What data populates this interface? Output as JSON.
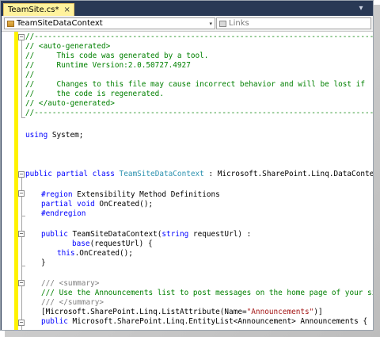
{
  "tab": {
    "title": "TeamSite.cs*",
    "close_glyph": "×"
  },
  "tabstrip": {
    "overflow_glyph": "▾"
  },
  "navbar": {
    "type_combo": "TeamSiteDataContext",
    "member_combo": "Links",
    "arrow_glyph": "▾"
  },
  "colors": {
    "chrome": "#293955",
    "active_tab": "#fff29d",
    "change_bar": "#fff200",
    "comment": "#008000",
    "keyword": "#0000ff",
    "type": "#2b91af",
    "string": "#a31515",
    "doc_tag": "#808080"
  },
  "code": {
    "l1": "//------------------------------------------------------------------------------",
    "l2": "// <auto-generated>",
    "l3": "//     This code was generated by a tool.",
    "l4": "//     Runtime Version:2.0.50727.4927",
    "l5": "//",
    "l6": "//     Changes to this file may cause incorrect behavior and will be lost if",
    "l7": "//     the code is regenerated.",
    "l8": "// </auto-generated>",
    "l9": "//------------------------------------------------------------------------------",
    "using_kw": "using",
    "using_rest": " System;",
    "cls_kw": "public partial class",
    "cls_name": "TeamSiteDataContext",
    "cls_rest": " : Microsoft.SharePoint.Linq.DataContext {",
    "region_kw": "#region",
    "region_rest": " Extensibility Method Definitions",
    "partial_kw": "partial void",
    "partial_rest": " OnCreated();",
    "endregion_kw": "#endregion",
    "ctor_kw": "public",
    "ctor_mid": " TeamSiteDataContext(",
    "ctor_kw2": "string",
    "ctor_rest": " requestUrl) :",
    "base_kw": "base",
    "base_rest": "(requestUrl) {",
    "this_kw": "this",
    "this_rest": ".OnCreated();",
    "close_brace": "}",
    "doc1_pre": "/// ",
    "doc1_tag": "<summary>",
    "doc2": "/// Use the Announcements list to post messages on the home page of your site.",
    "doc3_pre": "/// ",
    "doc3_tag": "</summary>",
    "attr_pre": "[Microsoft.SharePoint.Linq.ListAttribute(Name=",
    "attr_str": "\"Announcements\"",
    "attr_post": ")]",
    "prop_kw": "public",
    "prop_rest": " Microsoft.SharePoint.Linq.EntityList<Announcement> Announcements {"
  }
}
